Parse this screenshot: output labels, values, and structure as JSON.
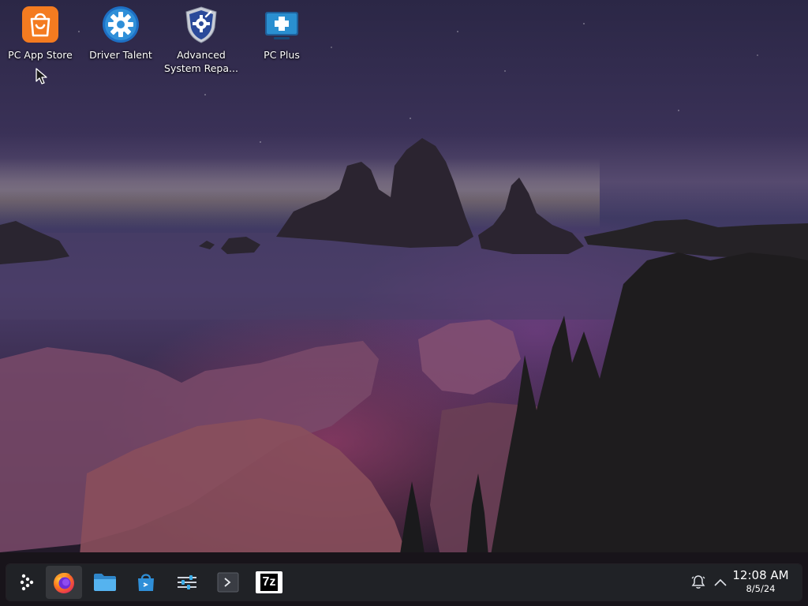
{
  "desktop": {
    "icons": [
      {
        "label": "PC App Store",
        "icon": "shopping-bag-icon",
        "color": "#f47b20"
      },
      {
        "label": "Driver Talent",
        "icon": "gear-icon",
        "color": "#2f8fd8"
      },
      {
        "label": "Advanced\nSystem Repa...",
        "icon": "shield-gear-icon",
        "color": "#2b4a9a"
      },
      {
        "label": "PC Plus",
        "icon": "medical-cross-icon",
        "color": "#2a8fd0"
      }
    ]
  },
  "taskbar": {
    "launcher": {
      "icon": "app-launcher-icon"
    },
    "apps": [
      {
        "name": "Firefox",
        "icon": "firefox-icon",
        "active": true
      },
      {
        "name": "Files",
        "icon": "folder-icon",
        "active": false
      },
      {
        "name": "Discover",
        "icon": "store-bag-icon",
        "active": false
      },
      {
        "name": "System Settings",
        "icon": "settings-sliders-icon",
        "active": false
      },
      {
        "name": "Terminal",
        "icon": "terminal-icon",
        "active": false
      },
      {
        "name": "7-Zip",
        "icon": "sevenzip-icon",
        "label": "7z",
        "active": false
      }
    ],
    "tray": {
      "notifications_icon": "bell-icon",
      "expand_icon": "chevron-up-icon"
    },
    "clock": {
      "time": "12:08 AM",
      "date": "8/5/24"
    }
  },
  "colors": {
    "accent": "#3daee9",
    "taskbar_bg": "#212328"
  }
}
